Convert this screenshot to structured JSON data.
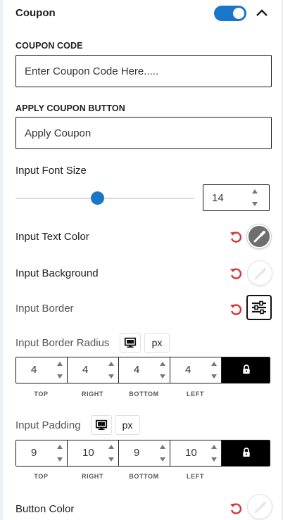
{
  "header": {
    "title": "Coupon",
    "toggle_on": true
  },
  "coupon_code": {
    "label": "COUPON CODE",
    "value": "Enter Coupon Code Here....."
  },
  "apply_button": {
    "label": "APPLY COUPON BUTTON",
    "value": "Apply Coupon"
  },
  "font_size": {
    "label": "Input Font Size",
    "value": "14",
    "slider_fraction": 0.46
  },
  "text_color": {
    "label": "Input Text Color",
    "color": "#6f6f6f"
  },
  "background": {
    "label": "Input Background",
    "color": "#ffffff"
  },
  "border": {
    "label": "Input Border"
  },
  "border_radius": {
    "label": "Input Border Radius",
    "unit": "px",
    "values": [
      "4",
      "4",
      "4",
      "4"
    ],
    "sides": [
      "TOP",
      "RIGHT",
      "BOTTOM",
      "LEFT"
    ]
  },
  "padding": {
    "label": "Input Padding",
    "unit": "px",
    "values": [
      "9",
      "10",
      "9",
      "10"
    ],
    "sides": [
      "TOP",
      "RIGHT",
      "BOTTOM",
      "LEFT"
    ]
  },
  "button_color": {
    "label": "Button Color",
    "color": "#ffffff"
  },
  "colors": {
    "accent": "#1976c8",
    "reset": "#d63638"
  }
}
